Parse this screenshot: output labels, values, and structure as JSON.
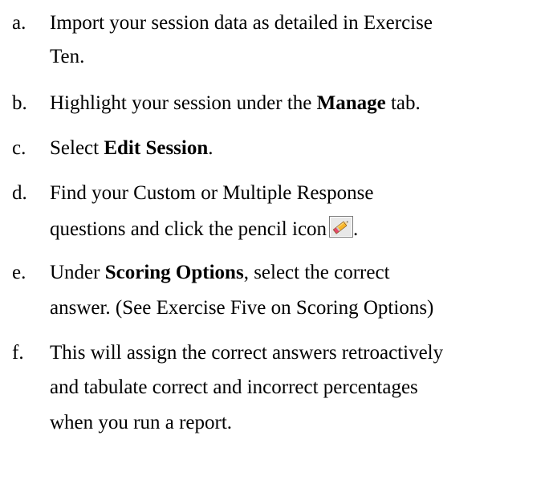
{
  "steps": [
    {
      "marker": "a.",
      "lines": [
        "Import your session data as detailed in Exercise",
        "Ten."
      ]
    },
    {
      "marker": "b.",
      "before": "Highlight your session under the ",
      "bold": "Manage",
      "after": " tab."
    },
    {
      "marker": "c.",
      "before": "Select ",
      "bold": "Edit Session",
      "after": "."
    },
    {
      "marker": "d.",
      "line1": "Find your Custom or Multiple Response",
      "line2_before": "questions and click the pencil icon",
      "line2_after": ".",
      "icon": "pencil-icon"
    },
    {
      "marker": "e.",
      "before": "Under ",
      "bold": "Scoring Options",
      "after": ", select the correct",
      "line2": "answer. (See Exercise Five on Scoring Options)"
    },
    {
      "marker": "f.",
      "lines": [
        "This will assign the correct answers retroactively",
        "and tabulate correct and incorrect percentages",
        "when you run a report."
      ]
    }
  ]
}
